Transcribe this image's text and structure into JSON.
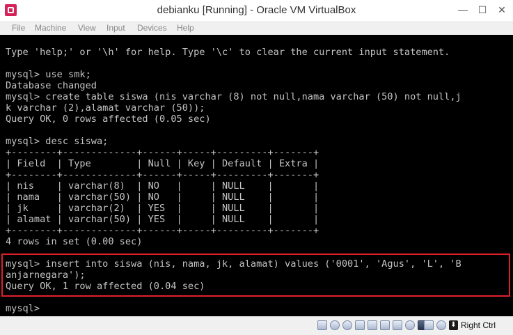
{
  "window": {
    "title": "debianku [Running] - Oracle VM VirtualBox",
    "minimize_glyph": "—",
    "maximize_glyph": "☐",
    "close_glyph": "✕"
  },
  "menu": [
    "File",
    "Machine",
    "View",
    "Input",
    "Devices",
    "Help"
  ],
  "terminal": {
    "lines": [
      "",
      "Type 'help;' or '\\h' for help. Type '\\c' to clear the current input statement.",
      "",
      "mysql> use smk;",
      "Database changed",
      "mysql> create table siswa (nis varchar (8) not null,nama varchar (50) not null,j",
      "k varchar (2),alamat varchar (50));",
      "Query OK, 0 rows affected (0.05 sec)",
      "",
      "mysql> desc siswa;",
      "+--------+-------------+------+-----+---------+-------+",
      "| Field  | Type        | Null | Key | Default | Extra |",
      "+--------+-------------+------+-----+---------+-------+",
      "| nis    | varchar(8)  | NO   |     | NULL    |       |",
      "| nama   | varchar(50) | NO   |     | NULL    |       |",
      "| jk     | varchar(2)  | YES  |     | NULL    |       |",
      "| alamat | varchar(50) | YES  |     | NULL    |       |",
      "+--------+-------------+------+-----+---------+-------+",
      "4 rows in set (0.00 sec)",
      "",
      "mysql> insert into siswa (nis, nama, jk, alamat) values ('0001', 'Agus', 'L', 'B",
      "anjarnegara');",
      "Query OK, 1 row affected (0.04 sec)",
      "",
      "mysql> "
    ]
  },
  "statusbar": {
    "icons": [
      "hard-disk-icon",
      "optical-disk-icon",
      "audio-icon",
      "network-icon",
      "usb-icon",
      "shared-folders-icon",
      "display-icon",
      "video-capture-icon",
      "monitor-icon",
      "cpu-icon",
      "mouse-integration-icon"
    ],
    "host_key_glyph": "⬇",
    "host_key_label": "Right Ctrl"
  },
  "colors": {
    "terminal_bg": "#000000",
    "terminal_fg": "#c4c4c4",
    "highlight": "#e0202a"
  }
}
